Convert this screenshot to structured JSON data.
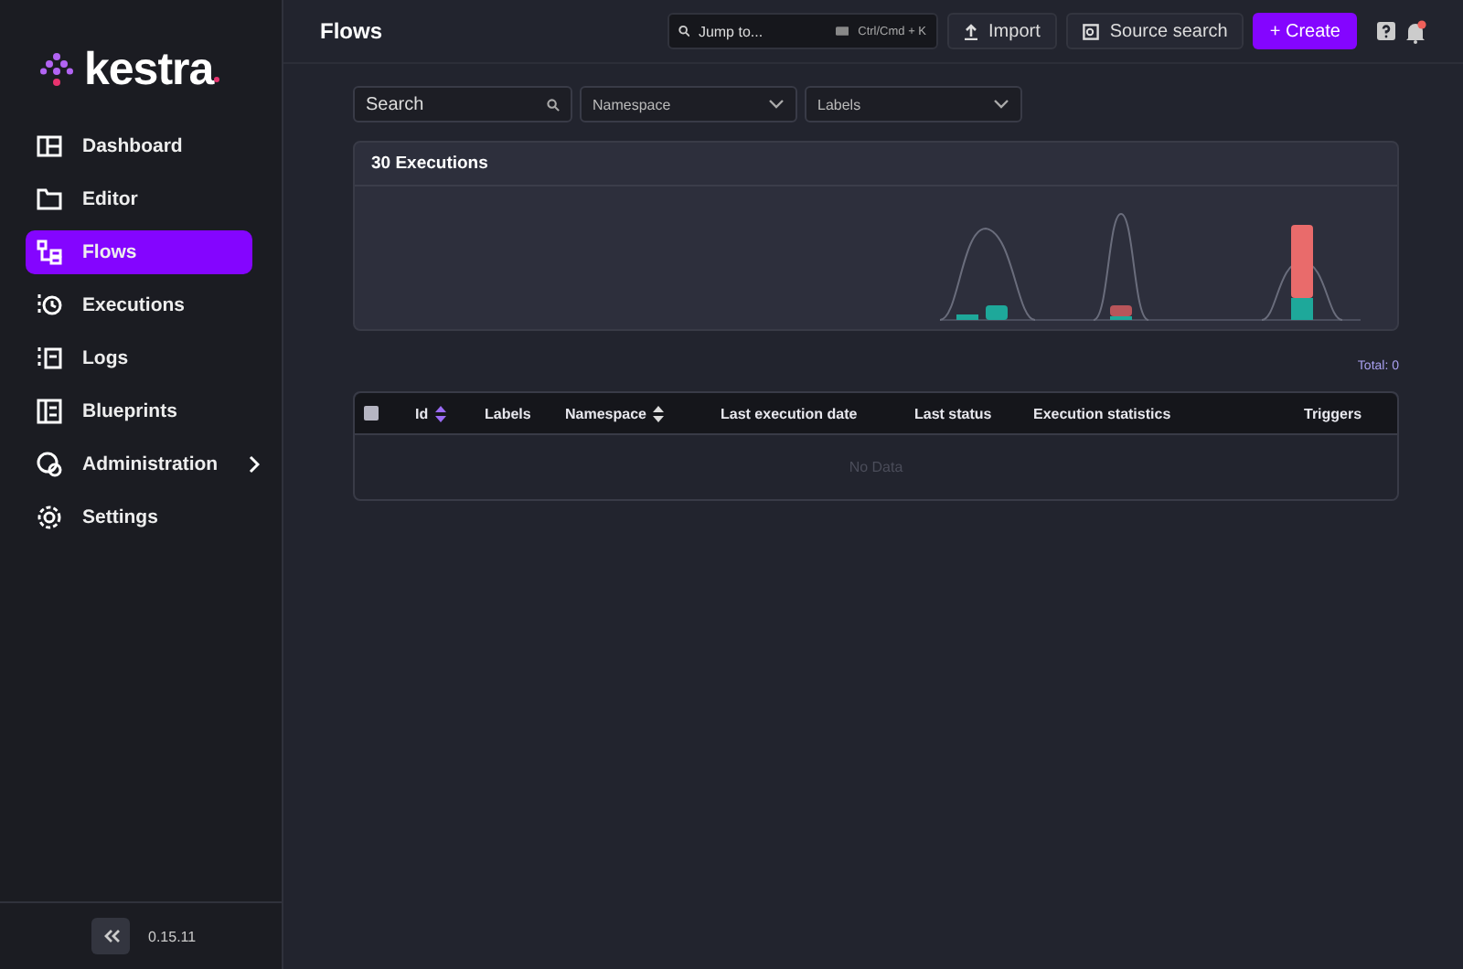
{
  "logo": {
    "text": "kestra"
  },
  "sidebar": {
    "items": [
      {
        "label": "Dashboard",
        "selected": false,
        "expandable": false
      },
      {
        "label": "Editor",
        "selected": false,
        "expandable": false
      },
      {
        "label": "Flows",
        "selected": true,
        "expandable": false
      },
      {
        "label": "Executions",
        "selected": false,
        "expandable": false
      },
      {
        "label": "Logs",
        "selected": false,
        "expandable": false
      },
      {
        "label": "Blueprints",
        "selected": false,
        "expandable": false
      },
      {
        "label": "Administration",
        "selected": false,
        "expandable": true
      },
      {
        "label": "Settings",
        "selected": false,
        "expandable": false
      }
    ],
    "version": "0.15.11"
  },
  "header": {
    "title": "Flows",
    "jump": {
      "placeholder": "Jump to...",
      "shortcut": "Ctrl/Cmd + K"
    },
    "buttons": [
      "Import",
      "Source search"
    ],
    "create": "+ Create",
    "has_notification": true
  },
  "filters": {
    "search": {
      "placeholder": "Search"
    },
    "dropdowns": [
      "Namespace",
      "Labels"
    ]
  },
  "executions_card": {
    "title": "30 Executions"
  },
  "total": "Total: 0",
  "table": {
    "columns": [
      {
        "label": "Id",
        "kind": "sorted"
      },
      {
        "label": "Labels",
        "kind": "plain"
      },
      {
        "label": "Namespace",
        "kind": "sortable"
      },
      {
        "label": "Last execution date",
        "kind": "plain"
      },
      {
        "label": "Last status",
        "kind": "plain"
      },
      {
        "label": "Execution statistics",
        "kind": "plain"
      },
      {
        "label": "Triggers",
        "kind": "plain"
      }
    ],
    "select_all_checked": false,
    "empty": "No Data"
  }
}
